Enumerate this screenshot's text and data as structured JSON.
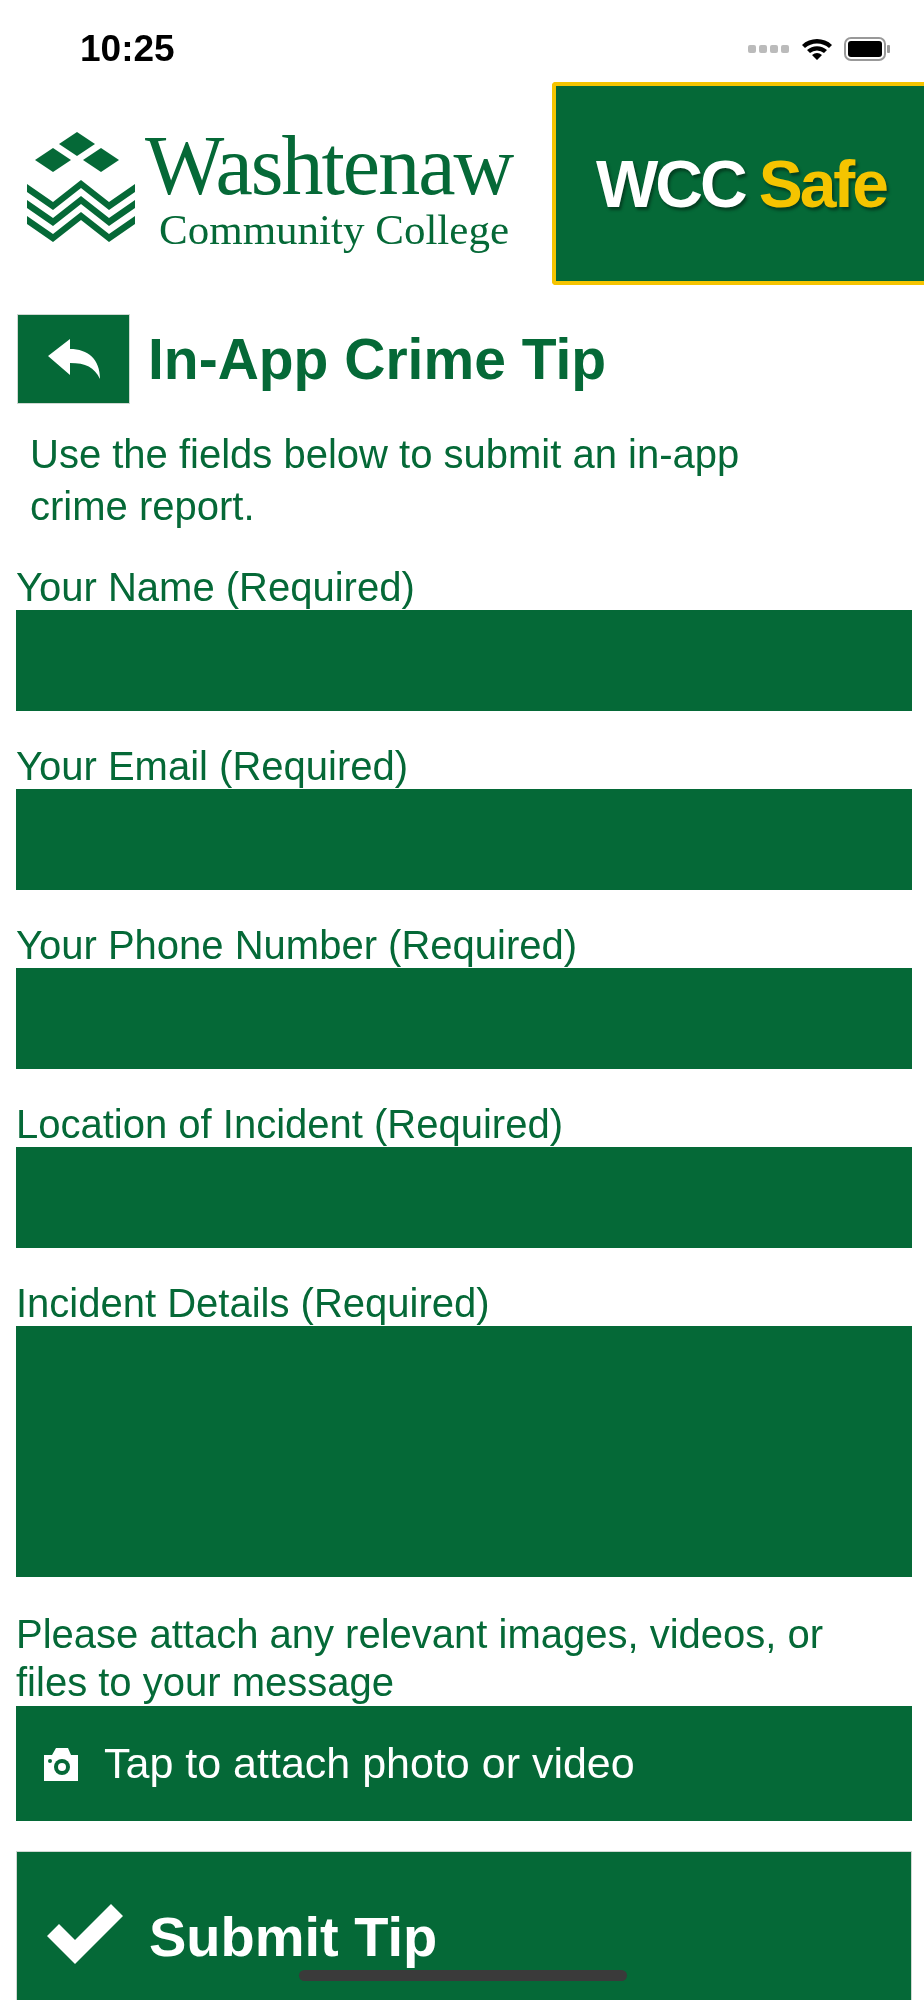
{
  "status_bar": {
    "time": "10:25"
  },
  "header": {
    "college_logo": {
      "name": "Washtenaw",
      "subtitle": "Community College"
    },
    "app_badge": {
      "name": "WCC",
      "accent": "Safe"
    }
  },
  "page": {
    "title": "In-App Crime Tip",
    "intro": "Use the fields below to submit an in-app crime report."
  },
  "fields": [
    {
      "label": "Your Name (Required)",
      "kind": "line"
    },
    {
      "label": "Your Email (Required)",
      "kind": "line"
    },
    {
      "label": "Your Phone Number (Required)",
      "kind": "line"
    },
    {
      "label": "Location of Incident (Required)",
      "kind": "line"
    },
    {
      "label": "Incident Details (Required)",
      "kind": "multiline"
    }
  ],
  "attachments": {
    "prompt": "Please attach any relevant images, videos, or files to your message",
    "button": "Tap to attach photo or video"
  },
  "submit_button": "Submit Tip"
}
